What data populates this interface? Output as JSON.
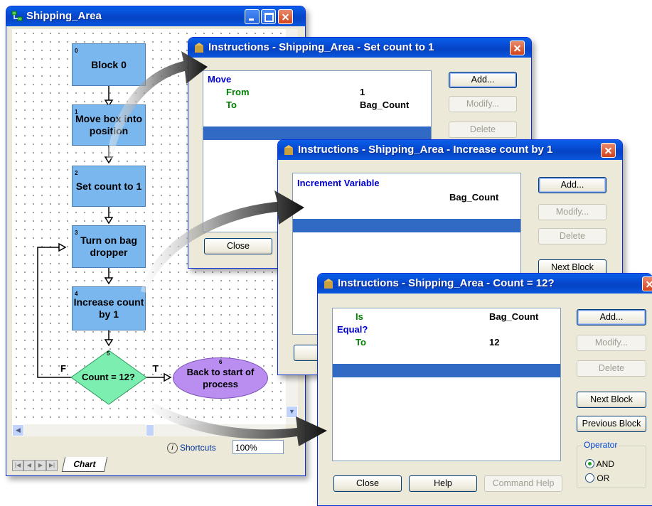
{
  "main_window": {
    "title": "Shipping_Area",
    "blocks": [
      {
        "num": "0",
        "label": "Block 0"
      },
      {
        "num": "1",
        "label": "Move box into position"
      },
      {
        "num": "2",
        "label": "Set count to 1"
      },
      {
        "num": "3",
        "label": "Turn on bag dropper"
      },
      {
        "num": "4",
        "label": "Increase count by 1"
      },
      {
        "num": "5",
        "label": "Count = 12?"
      },
      {
        "num": "6",
        "label": "Back to start of process"
      }
    ],
    "branch_false": "F",
    "branch_true": "T",
    "shortcuts_label": "Shortcuts",
    "zoom": "100%",
    "tab_chart": "Chart"
  },
  "dialog1": {
    "title": "Instructions - Shipping_Area - Set count to 1",
    "instruction": "Move",
    "param1_label": "From",
    "param1_value": "1",
    "param2_label": "To",
    "param2_value": "Bag_Count",
    "add": "Add...",
    "modify": "Modify...",
    "delete": "Delete",
    "close": "Close"
  },
  "dialog2": {
    "title": "Instructions - Shipping_Area - Increase count by 1",
    "instruction": "Increment Variable",
    "value": "Bag_Count",
    "add": "Add...",
    "modify": "Modify...",
    "delete": "Delete",
    "next_block": "Next Block"
  },
  "dialog3": {
    "title": "Instructions - Shipping_Area - Count = 12?",
    "row1_label": "Is",
    "row1_value": "Bag_Count",
    "row2_label": "Equal?",
    "row3_label": "To",
    "row3_value": "12",
    "add": "Add...",
    "modify": "Modify...",
    "delete": "Delete",
    "next_block": "Next Block",
    "previous_block": "Previous Block",
    "operator_label": "Operator",
    "and": "AND",
    "or": "OR",
    "operator_selected": "AND",
    "close": "Close",
    "help": "Help",
    "command_help": "Command Help"
  }
}
